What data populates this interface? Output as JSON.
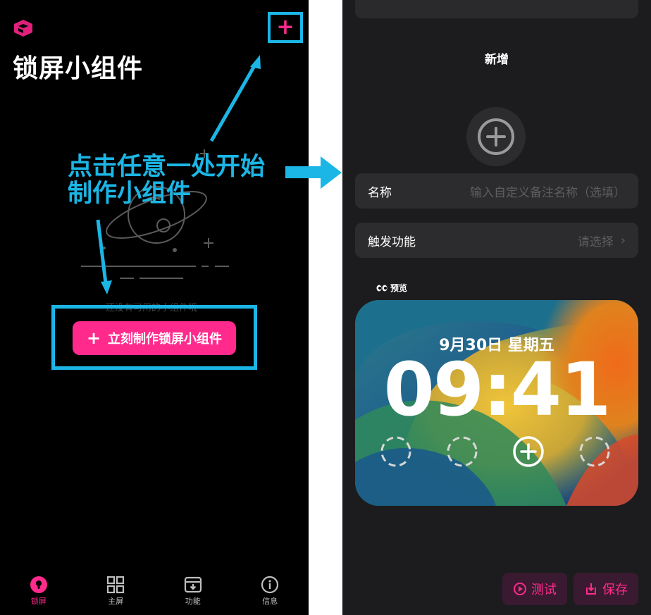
{
  "left": {
    "title": "锁屏小组件",
    "add_button": "+",
    "empty_hint": "还没有可用的小组件哦",
    "create_button": "立刻制作锁屏小组件",
    "annotation_line1": "点击任意一处开始",
    "annotation_line2": "制作小组件",
    "tabs": [
      {
        "label": "锁屏",
        "icon": "lock-icon",
        "active": true
      },
      {
        "label": "主屏",
        "icon": "grid-icon",
        "active": false
      },
      {
        "label": "功能",
        "icon": "archive-icon",
        "active": false
      },
      {
        "label": "信息",
        "icon": "info-icon",
        "active": false
      }
    ],
    "colors": {
      "accent": "#ff2a8c",
      "annotation": "#1bb6e6"
    }
  },
  "right": {
    "sheet_title": "新增",
    "name_row": {
      "label": "名称",
      "placeholder": "输入自定义备注名称（选填）"
    },
    "trigger_row": {
      "label": "触发功能",
      "value": "请选择"
    },
    "preview_label": "预览",
    "preview": {
      "date": "9月30日  星期五",
      "time": "09:41"
    },
    "buttons": {
      "test": "测试",
      "save": "保存"
    }
  }
}
